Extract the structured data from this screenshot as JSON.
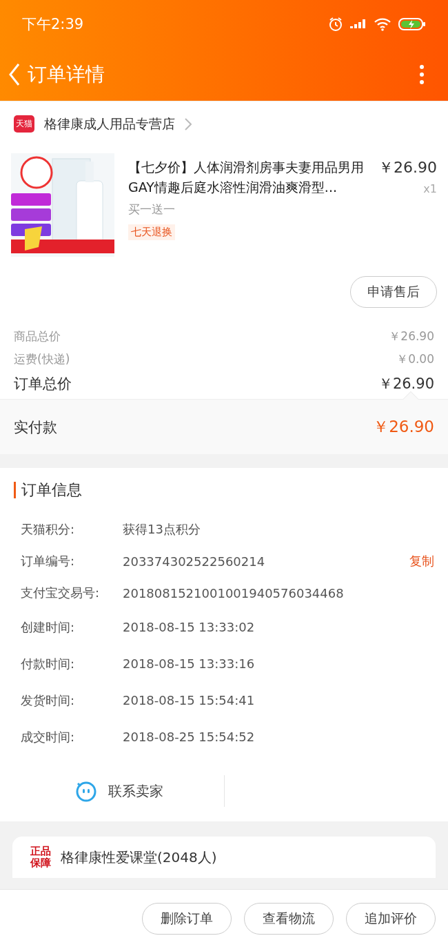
{
  "status_bar": {
    "time": "下午2:39"
  },
  "nav": {
    "title": "订单详情"
  },
  "store": {
    "badge": "天猫",
    "name": "格律康成人用品专营店"
  },
  "product": {
    "title": "【七夕价】人体润滑剂房事夫妻用品男用GAY情趣后庭水溶性润滑油爽滑型...",
    "price": "￥26.90",
    "quantity": "x1",
    "sku": "买一送一",
    "tag": "七天退换",
    "after_sale_button": "申请售后"
  },
  "price_rows": [
    {
      "label": "商品总价",
      "value": "￥26.90",
      "kind": "minor"
    },
    {
      "label": "运费(快递)",
      "value": "￥0.00",
      "kind": "minor"
    },
    {
      "label": "订单总价",
      "value": "￥26.90",
      "kind": "major"
    }
  ],
  "paid": {
    "label": "实付款",
    "value": "￥26.90"
  },
  "order_info": {
    "title": "订单信息",
    "rows": [
      {
        "label": "天猫积分:",
        "value": "获得13点积分"
      },
      {
        "label": "订单编号:",
        "value": "203374302522560214",
        "action": "复制"
      },
      {
        "label": "支付宝交易号:",
        "value": "2018081521001001940576034468"
      },
      {
        "label": "创建时间:",
        "value": "2018-08-15 13:33:02"
      },
      {
        "label": "付款时间:",
        "value": "2018-08-15 13:33:16"
      },
      {
        "label": "发货时间:",
        "value": "2018-08-15 15:54:41"
      },
      {
        "label": "成交时间:",
        "value": "2018-08-25 15:54:52"
      }
    ],
    "contact": "联系卖家"
  },
  "group_card": {
    "badge": "正品保障",
    "name": "格律康性爱课堂(2048人)"
  },
  "bottom_buttons": [
    "删除订单",
    "查看物流",
    "追加评价"
  ]
}
